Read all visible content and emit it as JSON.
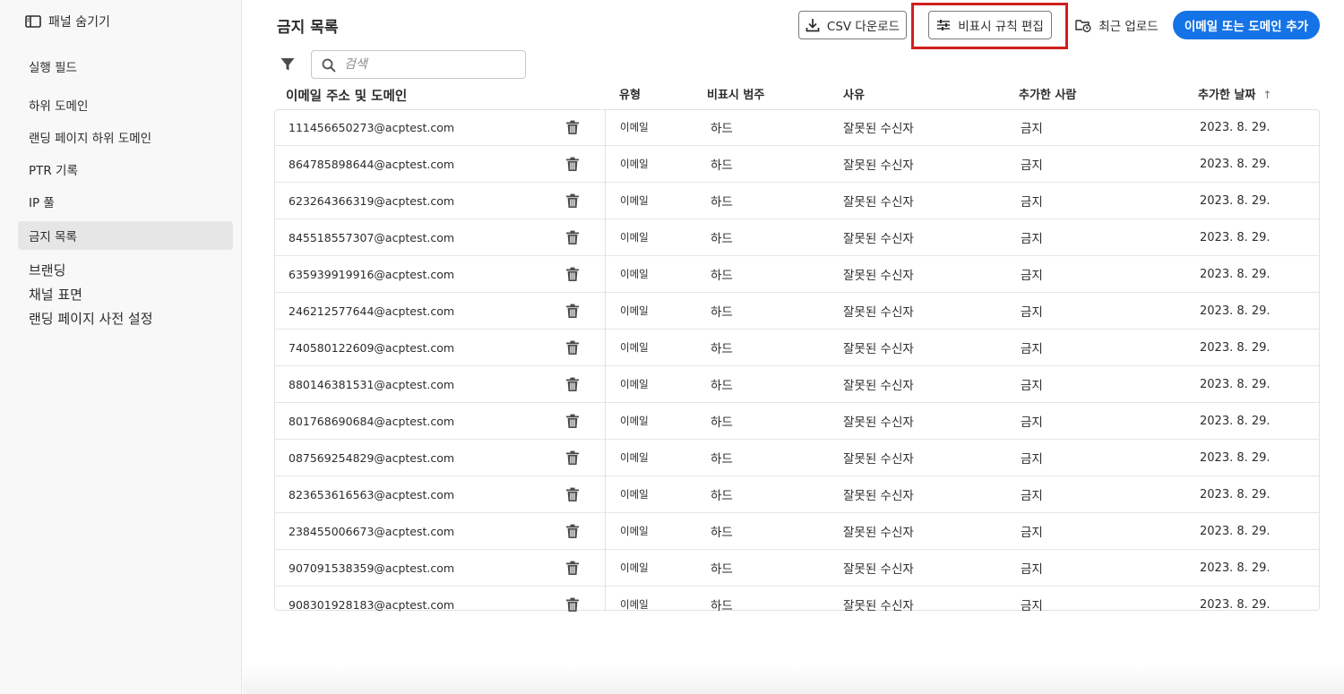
{
  "sidebar": {
    "hide_panel_label": "패널 숨기기",
    "items": [
      {
        "label": "실행 필드"
      },
      {
        "label": "하위 도메인"
      },
      {
        "label": "랜딩 페이지 하위 도메인"
      },
      {
        "label": "PTR 기록"
      },
      {
        "label": "IP 풀"
      },
      {
        "label": "금지 목록",
        "selected": true
      }
    ],
    "groups": [
      {
        "label": "브랜딩"
      },
      {
        "label": "채널 표면"
      },
      {
        "label": "랜딩 페이지 사전 설정"
      }
    ]
  },
  "header": {
    "title": "금지 목록",
    "csv_download_label": "CSV 다운로드",
    "edit_rules_label": "비표시 규칙 편집",
    "recent_uploads_label": "최근 업로드",
    "add_label": "이메일 또는 도메인 추가"
  },
  "search": {
    "placeholder": "검색",
    "value": ""
  },
  "table": {
    "columns": {
      "email": "이메일 주소 및 도메인",
      "type": "유형",
      "category": "비표시 범주",
      "reason": "사유",
      "added_by": "추가한 사람",
      "added_date": "추가한 날짜"
    },
    "rows": [
      {
        "email": "111456650273@acptest.com",
        "type": "이메일",
        "category": "하드",
        "reason": "잘못된 수신자",
        "added_by": "금지",
        "date": "2023. 8. 29."
      },
      {
        "email": "864785898644@acptest.com",
        "type": "이메일",
        "category": "하드",
        "reason": "잘못된 수신자",
        "added_by": "금지",
        "date": "2023. 8. 29."
      },
      {
        "email": "623264366319@acptest.com",
        "type": "이메일",
        "category": "하드",
        "reason": "잘못된 수신자",
        "added_by": "금지",
        "date": "2023. 8. 29."
      },
      {
        "email": "845518557307@acptest.com",
        "type": "이메일",
        "category": "하드",
        "reason": "잘못된 수신자",
        "added_by": "금지",
        "date": "2023. 8. 29."
      },
      {
        "email": "635939919916@acptest.com",
        "type": "이메일",
        "category": "하드",
        "reason": "잘못된 수신자",
        "added_by": "금지",
        "date": "2023. 8. 29."
      },
      {
        "email": "246212577644@acptest.com",
        "type": "이메일",
        "category": "하드",
        "reason": "잘못된 수신자",
        "added_by": "금지",
        "date": "2023. 8. 29."
      },
      {
        "email": "740580122609@acptest.com",
        "type": "이메일",
        "category": "하드",
        "reason": "잘못된 수신자",
        "added_by": "금지",
        "date": "2023. 8. 29."
      },
      {
        "email": "880146381531@acptest.com",
        "type": "이메일",
        "category": "하드",
        "reason": "잘못된 수신자",
        "added_by": "금지",
        "date": "2023. 8. 29."
      },
      {
        "email": "801768690684@acptest.com",
        "type": "이메일",
        "category": "하드",
        "reason": "잘못된 수신자",
        "added_by": "금지",
        "date": "2023. 8. 29."
      },
      {
        "email": "087569254829@acptest.com",
        "type": "이메일",
        "category": "하드",
        "reason": "잘못된 수신자",
        "added_by": "금지",
        "date": "2023. 8. 29."
      },
      {
        "email": "823653616563@acptest.com",
        "type": "이메일",
        "category": "하드",
        "reason": "잘못된 수신자",
        "added_by": "금지",
        "date": "2023. 8. 29."
      },
      {
        "email": "238455006673@acptest.com",
        "type": "이메일",
        "category": "하드",
        "reason": "잘못된 수신자",
        "added_by": "금지",
        "date": "2023. 8. 29."
      },
      {
        "email": "907091538359@acptest.com",
        "type": "이메일",
        "category": "하드",
        "reason": "잘못된 수신자",
        "added_by": "금지",
        "date": "2023. 8. 29."
      },
      {
        "email": "908301928183@acptest.com",
        "type": "이메일",
        "category": "하드",
        "reason": "잘못된 수신자",
        "added_by": "금지",
        "date": "2023. 8. 29."
      }
    ]
  },
  "colors": {
    "accent": "#1473e6",
    "highlight": "#d0201d",
    "sidebar_bg": "#f8f8f8",
    "selected_bg": "#e6e6e6"
  },
  "icons": {
    "hide_panel": "panel-icon",
    "csv": "download-icon",
    "rules": "sliders-icon",
    "upload": "folder-clock-icon",
    "filter": "filter-icon",
    "search": "search-icon",
    "row_action": "trash-icon",
    "sort": "arrow-up-icon"
  }
}
